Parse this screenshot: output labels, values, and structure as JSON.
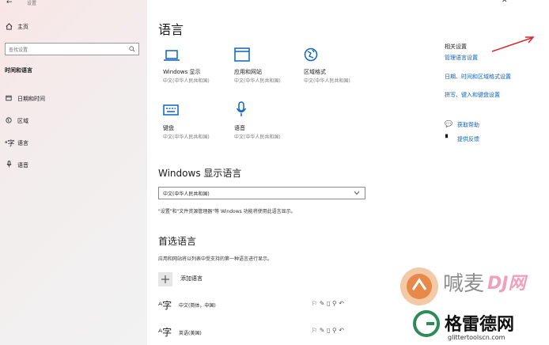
{
  "sidebar": {
    "back_label": "设置",
    "home_label": "主页",
    "search_placeholder": "查找设置",
    "section_title": "时间和语言",
    "items": [
      {
        "label": "日期和时间",
        "icon": "calendar-clock-icon"
      },
      {
        "label": "区域",
        "icon": "globe-icon"
      },
      {
        "label": "语言",
        "icon": "language-icon"
      },
      {
        "label": "语音",
        "icon": "microphone-icon"
      }
    ]
  },
  "main": {
    "title": "语言",
    "tiles": [
      {
        "title": "Windows 显示",
        "subtitle": "中文(中华人民共和国)",
        "icon": "laptop-icon"
      },
      {
        "title": "应用和网站",
        "subtitle": "中文(中华人民共和国)",
        "icon": "window-icon"
      },
      {
        "title": "区域格式",
        "subtitle": "中文(中华人民共和国)",
        "icon": "globe-icon"
      },
      {
        "title": "键盘",
        "subtitle": "中文(中华人民共和国)",
        "icon": "keyboard-icon"
      },
      {
        "title": "语音",
        "subtitle": "中文(中华人民共和国)",
        "icon": "microphone-icon"
      }
    ],
    "display_language_heading": "Windows 显示语言",
    "display_language_value": "中文(中华人民共和国)",
    "display_language_note": "\"设置\"和\"文件资源管理器\"等 Windows 功能将使用此语言显示。",
    "preferred_heading": "首选语言",
    "preferred_desc": "应用和网站将以列表中受支持的第一种语言进行显示。",
    "add_language_label": "添加语言",
    "languages": [
      {
        "name": "中文(简体，中国)"
      },
      {
        "name": "英语(美国)"
      }
    ]
  },
  "related": {
    "title": "相关设置",
    "links": [
      "管理语言设置",
      "日期、时间和区域格式设置",
      "拼写、键入和键盘设置"
    ],
    "help": [
      {
        "label": "获取帮助",
        "icon": "help-icon"
      },
      {
        "label": "提供反馈",
        "icon": "feedback-icon"
      }
    ]
  },
  "watermark": {
    "text1": "喊麦",
    "text2": "DJ网",
    "text3": "格雷德网",
    "url": "glittertoolscn.com"
  },
  "colors": {
    "accent": "#0b63c4",
    "arrow": "#d9272e"
  }
}
